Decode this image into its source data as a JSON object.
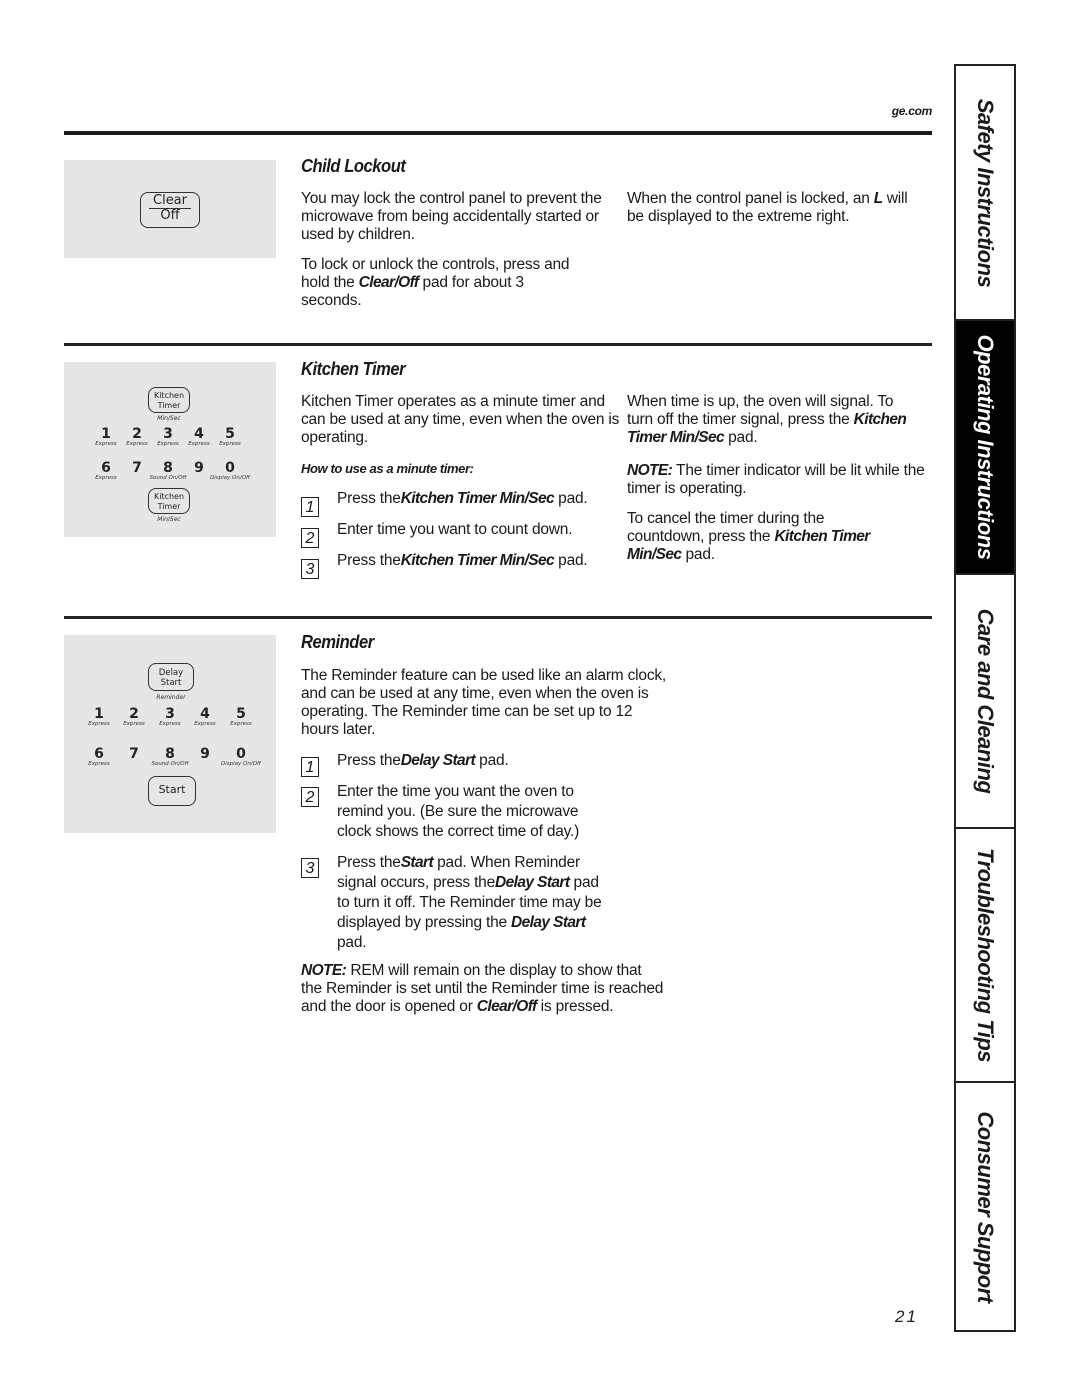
{
  "header": {
    "site": "ge.com"
  },
  "sections": {
    "child_lockout": {
      "title": "Child Lockout",
      "keypad": {
        "key_top": "Clear",
        "key_bottom": "Off"
      },
      "col1_p1": "You may lock the control panel to prevent the microwave from being accidentally started or used by children.",
      "col1_p2_pre": "To lock or unlock the controls, press and hold the ",
      "col1_p2_bold": "Clear/Off",
      "col1_p2_post": " pad for about 3 seconds.",
      "col2_pre": "When the control panel is locked, an ",
      "col2_bold": "L",
      "col2_post": " will be displayed to the extreme right."
    },
    "kitchen_timer": {
      "title": "Kitchen Timer",
      "keypad": {
        "top_key": [
          "Kitchen",
          "Timer"
        ],
        "top_caption": "Min/Sec",
        "row1": [
          {
            "num": "1",
            "cap": "Express"
          },
          {
            "num": "2",
            "cap": "Express"
          },
          {
            "num": "3",
            "cap": "Express"
          },
          {
            "num": "4",
            "cap": "Express"
          },
          {
            "num": "5",
            "cap": "Express"
          }
        ],
        "row2": [
          {
            "num": "6",
            "cap": "Express"
          },
          {
            "num": "7",
            "cap": ""
          },
          {
            "num": "8",
            "cap": "Sound On/Off"
          },
          {
            "num": "9",
            "cap": ""
          },
          {
            "num": "0",
            "cap": "Display On/Off"
          }
        ],
        "bottom_key": [
          "Kitchen",
          "Timer"
        ],
        "bottom_caption": "Min/Sec"
      },
      "intro": "Kitchen Timer operates as a minute timer and can be used at any time, even when the oven is operating.",
      "howto": "How to use as a minute timer:",
      "steps": [
        {
          "n": "1",
          "pre": "Press the",
          "bold": "Kitchen Timer Min/Sec",
          "post": " pad."
        },
        {
          "n": "2",
          "pre": "Enter time you want to count down.",
          "bold": "",
          "post": ""
        },
        {
          "n": "3",
          "pre": "Press the",
          "bold": "Kitchen Timer Min/Sec",
          "post": " pad."
        }
      ],
      "col2_p1_pre": "When time is up, the oven will signal. To turn off the timer signal, press the ",
      "col2_p1_bold": "Kitchen Timer Min/Sec",
      "col2_p1_post": " pad.",
      "col2_note_label": "NOTE:",
      "col2_note": " The timer indicator will be lit while the timer is operating.",
      "col2_p3_pre": "To cancel the timer during the countdown, press the ",
      "col2_p3_bold": "Kitchen Timer Min/Sec",
      "col2_p3_post": " pad."
    },
    "reminder": {
      "title": "Reminder",
      "keypad": {
        "top_key": [
          "Delay",
          "Start"
        ],
        "top_caption": "Reminder",
        "row1": [
          {
            "num": "1",
            "cap": "Express"
          },
          {
            "num": "2",
            "cap": "Express"
          },
          {
            "num": "3",
            "cap": "Express"
          },
          {
            "num": "4",
            "cap": "Express"
          },
          {
            "num": "5",
            "cap": "Express"
          }
        ],
        "row2": [
          {
            "num": "6",
            "cap": "Express"
          },
          {
            "num": "7",
            "cap": ""
          },
          {
            "num": "8",
            "cap": "Sound On/Off"
          },
          {
            "num": "9",
            "cap": ""
          },
          {
            "num": "0",
            "cap": "Display On/Off"
          }
        ],
        "bottom_key": "Start"
      },
      "intro": "The Reminder feature can be used like an alarm clock, and can be used at any time, even when the oven is operating. The Reminder time can be set up to 12 hours later.",
      "step1": {
        "n": "1",
        "pre": "Press the",
        "bold": "Delay Start",
        "post": " pad."
      },
      "step2": {
        "n": "2",
        "text": "Enter the time you want the oven to remind you. (Be sure the microwave clock shows the correct time of day.)"
      },
      "step3": {
        "n": "3",
        "pre": "Press the",
        "bold1": "Start",
        "mid": " pad. When Reminder signal occurs, press the",
        "bold2": "Delay Start",
        "mid2": " pad to turn it off. The Reminder time may be displayed by pressing the ",
        "bold3": "Delay Start",
        "post": " pad."
      },
      "note_label": "NOTE:",
      "note_pre": " REM will remain on the display to show that the Reminder is set until the Reminder time is reached and the door is opened or ",
      "note_bold": "Clear/Off",
      "note_post": " is pressed."
    }
  },
  "side_tabs": [
    {
      "label": "Safety Instructions",
      "active": false
    },
    {
      "label": "Operating Instructions",
      "active": true
    },
    {
      "label": "Care and Cleaning",
      "active": false
    },
    {
      "label": "Troubleshooting Tips",
      "active": false
    },
    {
      "label": "Consumer Support",
      "active": false
    }
  ],
  "footer": {
    "page_number": "21"
  }
}
